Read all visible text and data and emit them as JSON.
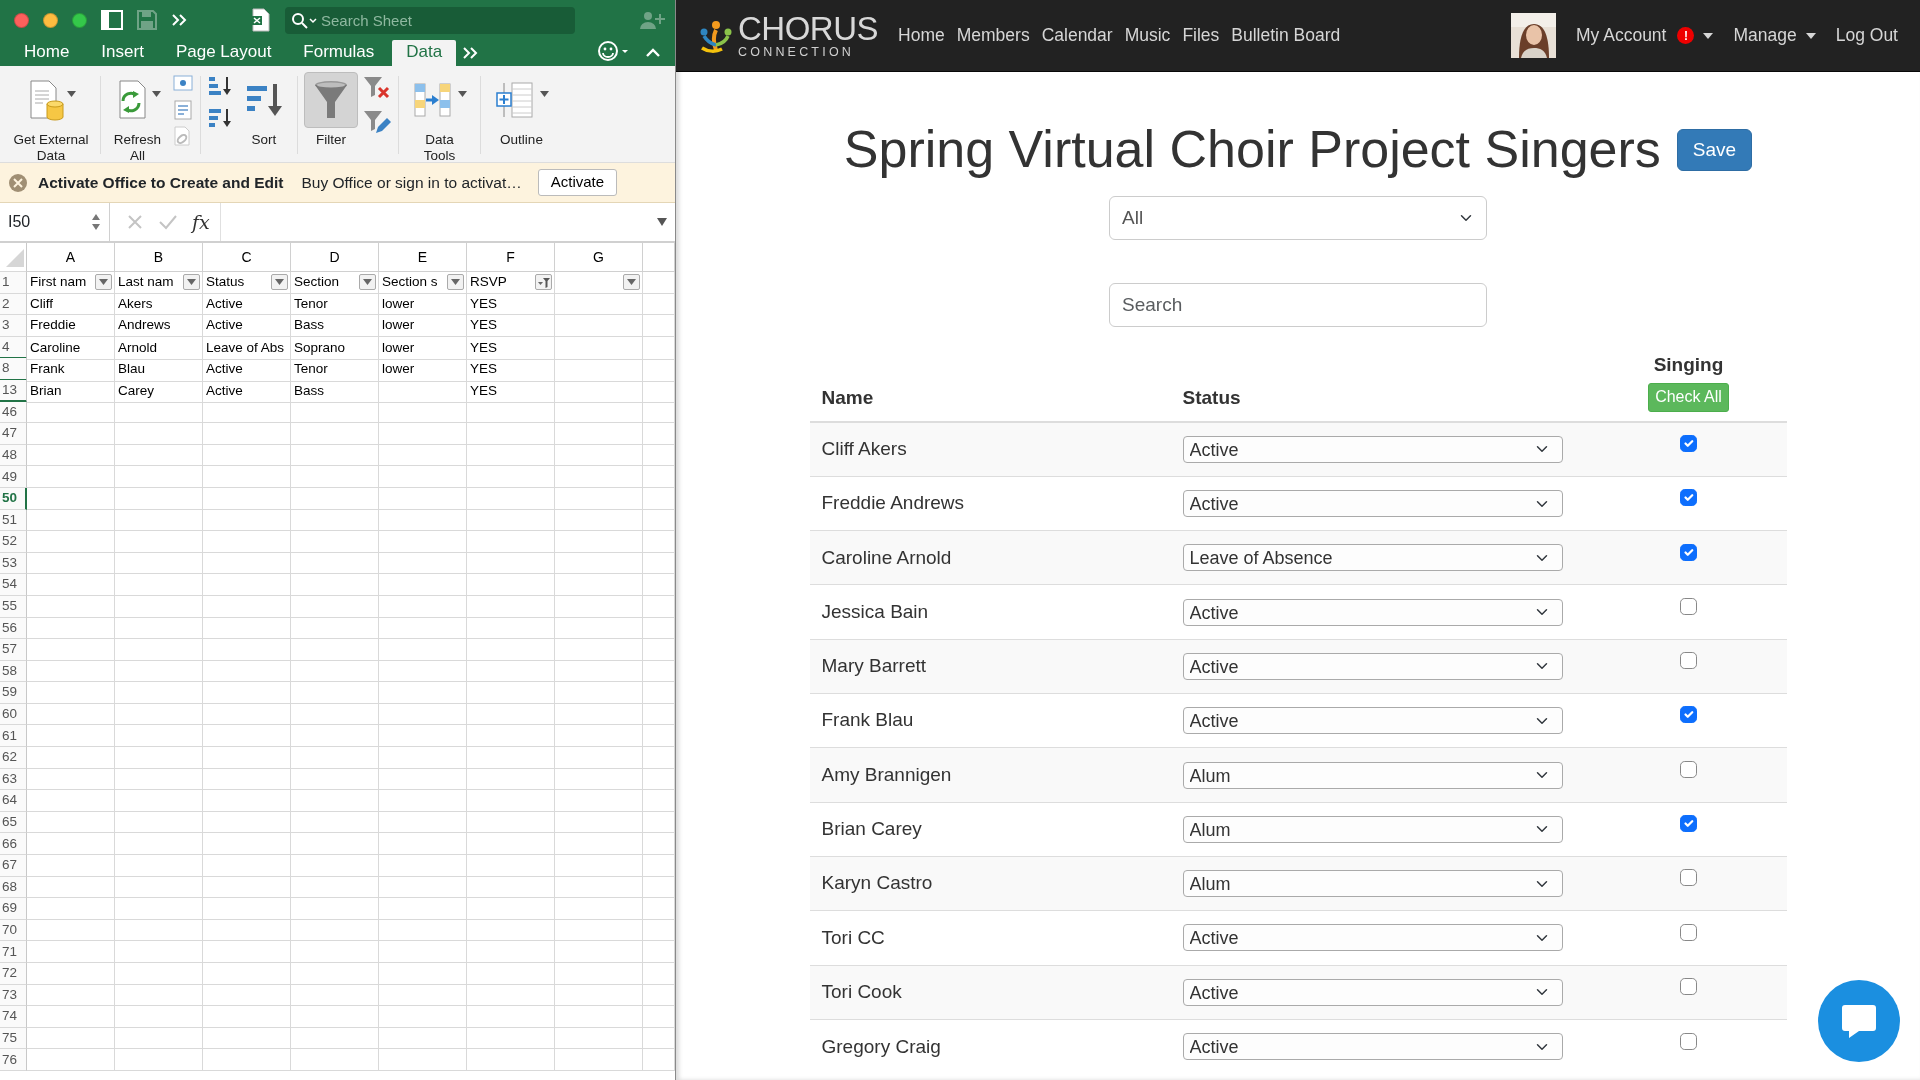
{
  "excel": {
    "search_placeholder": "Search Sheet",
    "tabs": [
      {
        "label": "Home",
        "selected": false
      },
      {
        "label": "Insert",
        "selected": false
      },
      {
        "label": "Page Layout",
        "selected": false
      },
      {
        "label": "Formulas",
        "selected": false
      },
      {
        "label": "Data",
        "selected": true
      }
    ],
    "ribbon": [
      {
        "label": "Get External Data",
        "kind": "database",
        "menu": true,
        "pressed": false
      },
      {
        "label": "Refresh All",
        "kind": "refresh",
        "menu": true,
        "pressed": false
      },
      {
        "label": "Sort",
        "kind": "sort",
        "menu": false,
        "pressed": false
      },
      {
        "label": "Filter",
        "kind": "filter",
        "menu": false,
        "pressed": true
      },
      {
        "label": "Data Tools",
        "kind": "tools",
        "menu": true,
        "pressed": false
      },
      {
        "label": "Outline",
        "kind": "outline",
        "menu": true,
        "pressed": false
      }
    ],
    "message_bar": {
      "title": "Activate Office to Create and Edit",
      "text": "Buy Office or sign in to activat…",
      "button": "Activate"
    },
    "name_box": "I50",
    "fx": "fx",
    "columns": [
      "A",
      "B",
      "C",
      "D",
      "E",
      "F",
      "G"
    ],
    "rows": [
      {
        "number": "1",
        "selected": false,
        "hidden_below": false,
        "cells": {
          "A": "First nam",
          "B": "Last nam",
          "C": "Status",
          "D": "Section",
          "E": "Section s",
          "F": "RSVP"
        },
        "filters": {
          "A": false,
          "B": false,
          "C": false,
          "D": false,
          "E": false,
          "F": true,
          "G": false
        }
      },
      {
        "number": "2",
        "selected": false,
        "hidden_below": false,
        "cells": {
          "A": "Cliff",
          "B": "Akers",
          "C": "Active",
          "D": "Tenor",
          "E": "lower",
          "F": "YES"
        }
      },
      {
        "number": "3",
        "selected": false,
        "hidden_below": false,
        "cells": {
          "A": "Freddie",
          "B": "Andrews",
          "C": "Active",
          "D": "Bass",
          "E": "lower",
          "F": "YES"
        }
      },
      {
        "number": "4",
        "selected": false,
        "hidden_below": true,
        "cells": {
          "A": "Caroline",
          "B": "Arnold",
          "C": "Leave of Abs",
          "D": "Soprano",
          "E": "lower",
          "F": "YES"
        }
      },
      {
        "number": "8",
        "selected": false,
        "hidden_below": true,
        "cells": {
          "A": "Frank",
          "B": "Blau",
          "C": "Active",
          "D": "Tenor",
          "E": "lower",
          "F": "YES"
        }
      },
      {
        "number": "13",
        "selected": false,
        "hidden_below": true,
        "cells": {
          "A": "Brian",
          "B": "Carey",
          "C": "Active",
          "D": "Bass",
          "F": "YES"
        }
      },
      {
        "number": "46",
        "selected": false,
        "hidden_below": false
      },
      {
        "number": "47",
        "selected": false,
        "hidden_below": false
      },
      {
        "number": "48",
        "selected": false,
        "hidden_below": false
      },
      {
        "number": "49",
        "selected": false,
        "hidden_below": false
      },
      {
        "number": "50",
        "selected": true,
        "hidden_below": false
      },
      {
        "number": "51",
        "selected": false,
        "hidden_below": false
      },
      {
        "number": "52",
        "selected": false,
        "hidden_below": false
      },
      {
        "number": "53",
        "selected": false,
        "hidden_below": false
      },
      {
        "number": "54",
        "selected": false,
        "hidden_below": false
      },
      {
        "number": "55",
        "selected": false,
        "hidden_below": false
      },
      {
        "number": "56",
        "selected": false,
        "hidden_below": false
      },
      {
        "number": "57",
        "selected": false,
        "hidden_below": false
      },
      {
        "number": "58",
        "selected": false,
        "hidden_below": false
      },
      {
        "number": "59",
        "selected": false,
        "hidden_below": false
      },
      {
        "number": "60",
        "selected": false,
        "hidden_below": false
      },
      {
        "number": "61",
        "selected": false,
        "hidden_below": false
      },
      {
        "number": "62",
        "selected": false,
        "hidden_below": false
      },
      {
        "number": "63",
        "selected": false,
        "hidden_below": false
      },
      {
        "number": "64",
        "selected": false,
        "hidden_below": false
      },
      {
        "number": "65",
        "selected": false,
        "hidden_below": false
      },
      {
        "number": "66",
        "selected": false,
        "hidden_below": false
      },
      {
        "number": "67",
        "selected": false,
        "hidden_below": false
      },
      {
        "number": "68",
        "selected": false,
        "hidden_below": false
      },
      {
        "number": "69",
        "selected": false,
        "hidden_below": false
      },
      {
        "number": "70",
        "selected": false,
        "hidden_below": false
      },
      {
        "number": "71",
        "selected": false,
        "hidden_below": false
      },
      {
        "number": "72",
        "selected": false,
        "hidden_below": false
      },
      {
        "number": "73",
        "selected": false,
        "hidden_below": false
      },
      {
        "number": "74",
        "selected": false,
        "hidden_below": false
      },
      {
        "number": "75",
        "selected": false,
        "hidden_below": false
      },
      {
        "number": "76",
        "selected": false,
        "hidden_below": false
      }
    ]
  },
  "chorus": {
    "logo": {
      "name": "CHORUS",
      "tagline": "CONNECTION"
    },
    "nav": [
      "Home",
      "Members",
      "Calendar",
      "Music",
      "Files",
      "Bulletin Board"
    ],
    "right_nav": [
      {
        "label": "My Account",
        "alert": "!",
        "menu": true
      },
      {
        "label": "Manage",
        "menu": true
      },
      {
        "label": "Log Out",
        "menu": false
      }
    ],
    "title": "Spring Virtual Choir Project Singers",
    "save_button": "Save",
    "group_filter": "All",
    "search_placeholder": "Search",
    "table": {
      "columns": [
        "Name",
        "Status",
        "Singing"
      ],
      "check_all": "Check All",
      "rows": [
        {
          "name": "Cliff Akers",
          "status": "Active",
          "checked": true
        },
        {
          "name": "Freddie Andrews",
          "status": "Active",
          "checked": true
        },
        {
          "name": "Caroline Arnold",
          "status": "Leave of Absence",
          "checked": true
        },
        {
          "name": "Jessica Bain",
          "status": "Active",
          "checked": false
        },
        {
          "name": "Mary Barrett",
          "status": "Active",
          "checked": false
        },
        {
          "name": "Frank Blau",
          "status": "Active",
          "checked": true
        },
        {
          "name": "Amy Brannigen",
          "status": "Alum",
          "checked": false
        },
        {
          "name": "Brian Carey",
          "status": "Alum",
          "checked": true
        },
        {
          "name": "Karyn Castro",
          "status": "Alum",
          "checked": false
        },
        {
          "name": "Tori CC",
          "status": "Active",
          "checked": false
        },
        {
          "name": "Tori Cook",
          "status": "Active",
          "checked": false
        },
        {
          "name": "Gregory Craig",
          "status": "Active",
          "checked": false
        }
      ]
    }
  }
}
